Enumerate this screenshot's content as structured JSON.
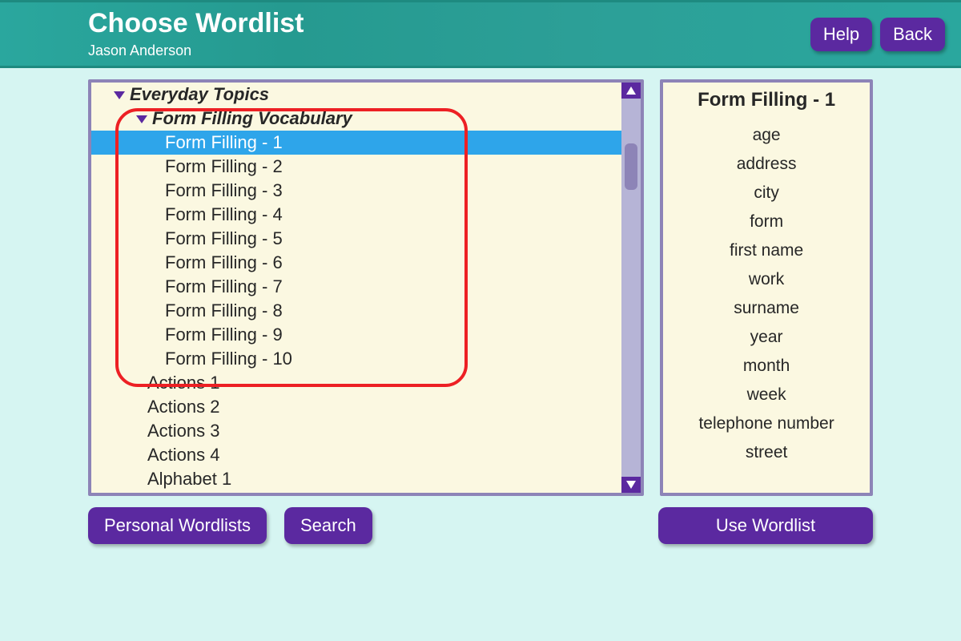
{
  "header": {
    "title": "Choose Wordlist",
    "subtitle": "Jason Anderson",
    "help": "Help",
    "back": "Back"
  },
  "tree": {
    "root": "Everyday Topics",
    "group": "Form Filling Vocabulary",
    "items": [
      "Form Filling - 1",
      "Form Filling - 2",
      "Form Filling - 3",
      "Form Filling - 4",
      "Form Filling - 5",
      "Form Filling - 6",
      "Form Filling - 7",
      "Form Filling - 8",
      "Form Filling - 9",
      "Form Filling - 10"
    ],
    "after": [
      "Actions 1",
      "Actions 2",
      "Actions 3",
      "Actions 4",
      "Alphabet 1"
    ],
    "selected_index": 0
  },
  "preview": {
    "title": "Form Filling - 1",
    "words": [
      "age",
      "address",
      "city",
      "form",
      "first name",
      "work",
      "surname",
      "year",
      "month",
      "week",
      "telephone number",
      "street"
    ]
  },
  "buttons": {
    "personal": "Personal Wordlists",
    "search": "Search",
    "use": "Use Wordlist"
  }
}
